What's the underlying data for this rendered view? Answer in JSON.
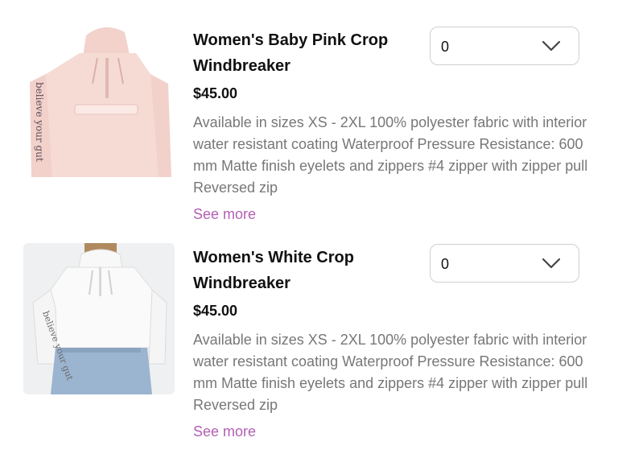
{
  "products": [
    {
      "title": "Women's Baby Pink Crop Windbreaker",
      "price": "$45.00",
      "description": "Available in sizes XS - 2XL 100% polyester fabric with interior water resistant coating Waterproof Pressure Resistance: 600 mm Matte finish eyelets and zippers #4 zipper with zipper pull Reversed zip",
      "see_more": "See more",
      "quantity": "0",
      "image_icon": "pink-windbreaker-photo",
      "color": "#f6d9d3"
    },
    {
      "title": "Women's White Crop Windbreaker",
      "price": "$45.00",
      "description": "Available in sizes XS - 2XL 100% polyester fabric with interior water resistant coating Waterproof Pressure Resistance: 600 mm Matte finish eyelets and zippers #4 zipper with zipper pull Reversed zip",
      "see_more": "See more",
      "quantity": "0",
      "image_icon": "white-windbreaker-photo",
      "color": "#f4f4f4"
    }
  ],
  "accent_color": "#b35fb3"
}
